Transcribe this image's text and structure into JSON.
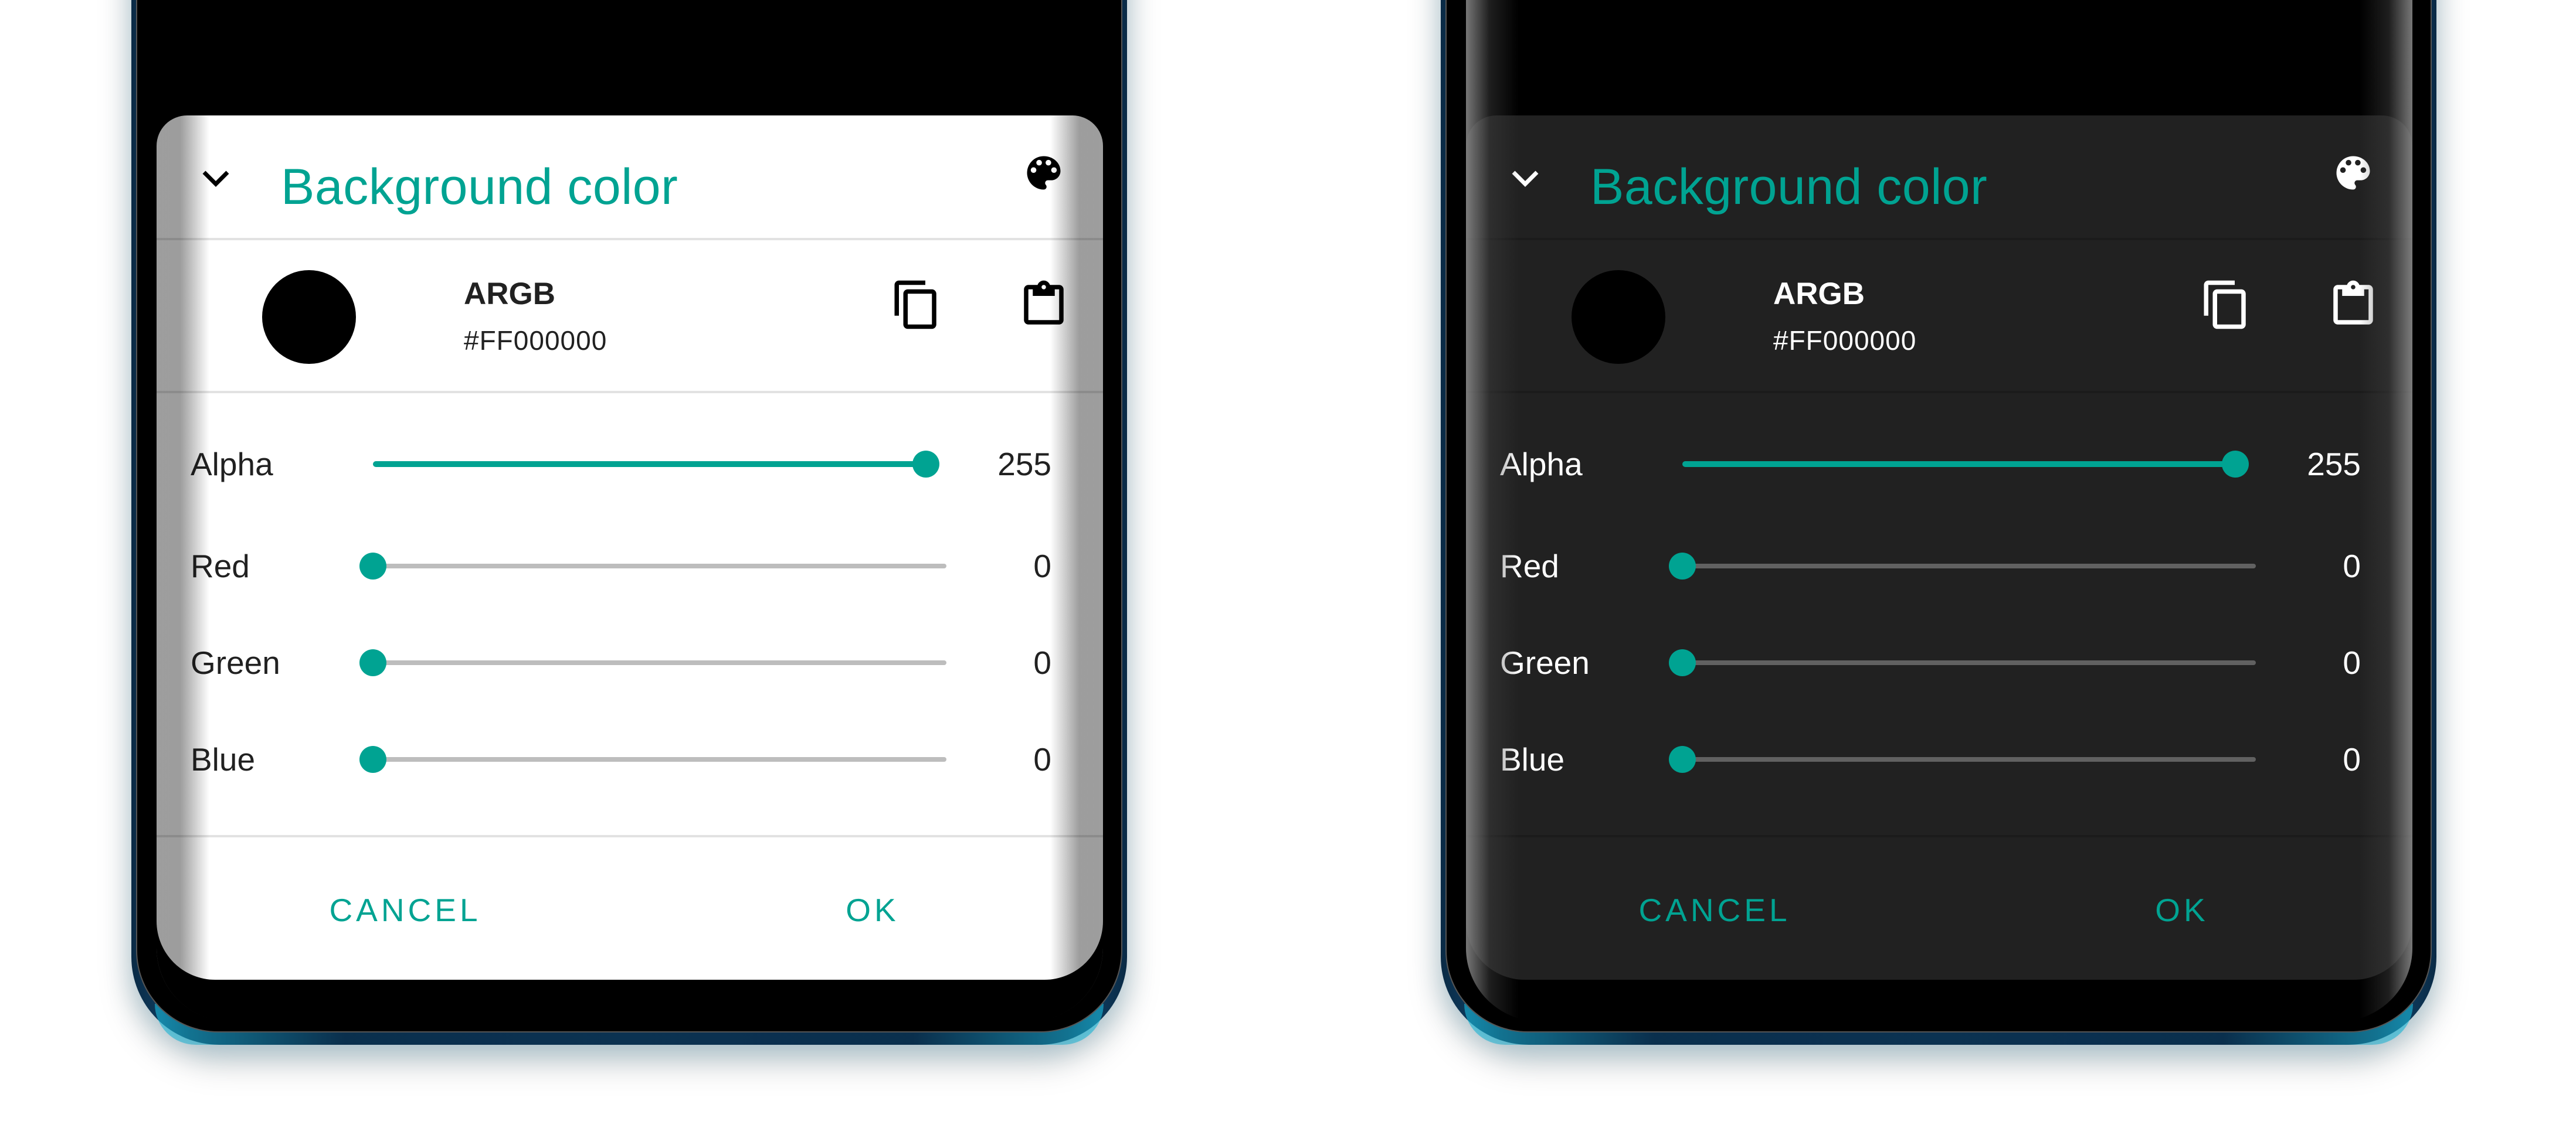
{
  "accent_color": "#00A392",
  "screens": [
    {
      "theme": "light",
      "dialog": {
        "title": "Background color",
        "collapse_icon": "chevron-down-icon",
        "header_icon": "palette-icon",
        "color_preview": {
          "color": "#000000"
        },
        "format_label": "ARGB",
        "hex_value": "#FF000000",
        "copy_icon": "copy-icon",
        "paste_icon": "clipboard-paste-icon",
        "sliders": [
          {
            "label": "Alpha",
            "value": "255",
            "fraction": 1.0
          },
          {
            "label": "Red",
            "value": "0",
            "fraction": 0.0
          },
          {
            "label": "Green",
            "value": "0",
            "fraction": 0.0
          },
          {
            "label": "Blue",
            "value": "0",
            "fraction": 0.0
          }
        ],
        "buttons": {
          "cancel": "CANCEL",
          "ok": "OK"
        }
      }
    },
    {
      "theme": "dark",
      "dialog": {
        "title": "Background color",
        "collapse_icon": "chevron-down-icon",
        "header_icon": "palette-icon",
        "color_preview": {
          "color": "#000000"
        },
        "format_label": "ARGB",
        "hex_value": "#FF000000",
        "copy_icon": "copy-icon",
        "paste_icon": "clipboard-paste-icon",
        "sliders": [
          {
            "label": "Alpha",
            "value": "255",
            "fraction": 1.0
          },
          {
            "label": "Red",
            "value": "0",
            "fraction": 0.0
          },
          {
            "label": "Green",
            "value": "0",
            "fraction": 0.0
          },
          {
            "label": "Blue",
            "value": "0",
            "fraction": 0.0
          }
        ],
        "buttons": {
          "cancel": "CANCEL",
          "ok": "OK"
        }
      }
    }
  ]
}
